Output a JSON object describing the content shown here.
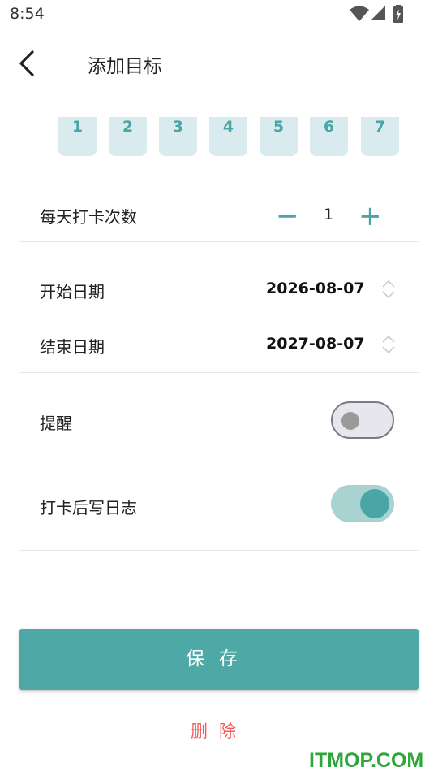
{
  "status_bar": {
    "time": "8:54"
  },
  "header": {
    "title": "添加目标"
  },
  "days": [
    "1",
    "2",
    "3",
    "4",
    "5",
    "6",
    "7"
  ],
  "daily_count": {
    "label": "每天打卡次数",
    "minus": "−",
    "value": "1",
    "plus": "+"
  },
  "dates": {
    "start_label": "开始日期",
    "start_value": "2026-08-07",
    "end_label": "结束日期",
    "end_value": "2027-08-07"
  },
  "reminder": {
    "label": "提醒",
    "enabled": false
  },
  "journal": {
    "label": "打卡后写日志",
    "enabled": true
  },
  "buttons": {
    "save": "保存",
    "delete": "删除"
  },
  "watermark": "ITMOP.COM",
  "colors": {
    "accent": "#4ea9a6",
    "danger": "#f05a5a",
    "day_bg": "#d9ebee"
  }
}
